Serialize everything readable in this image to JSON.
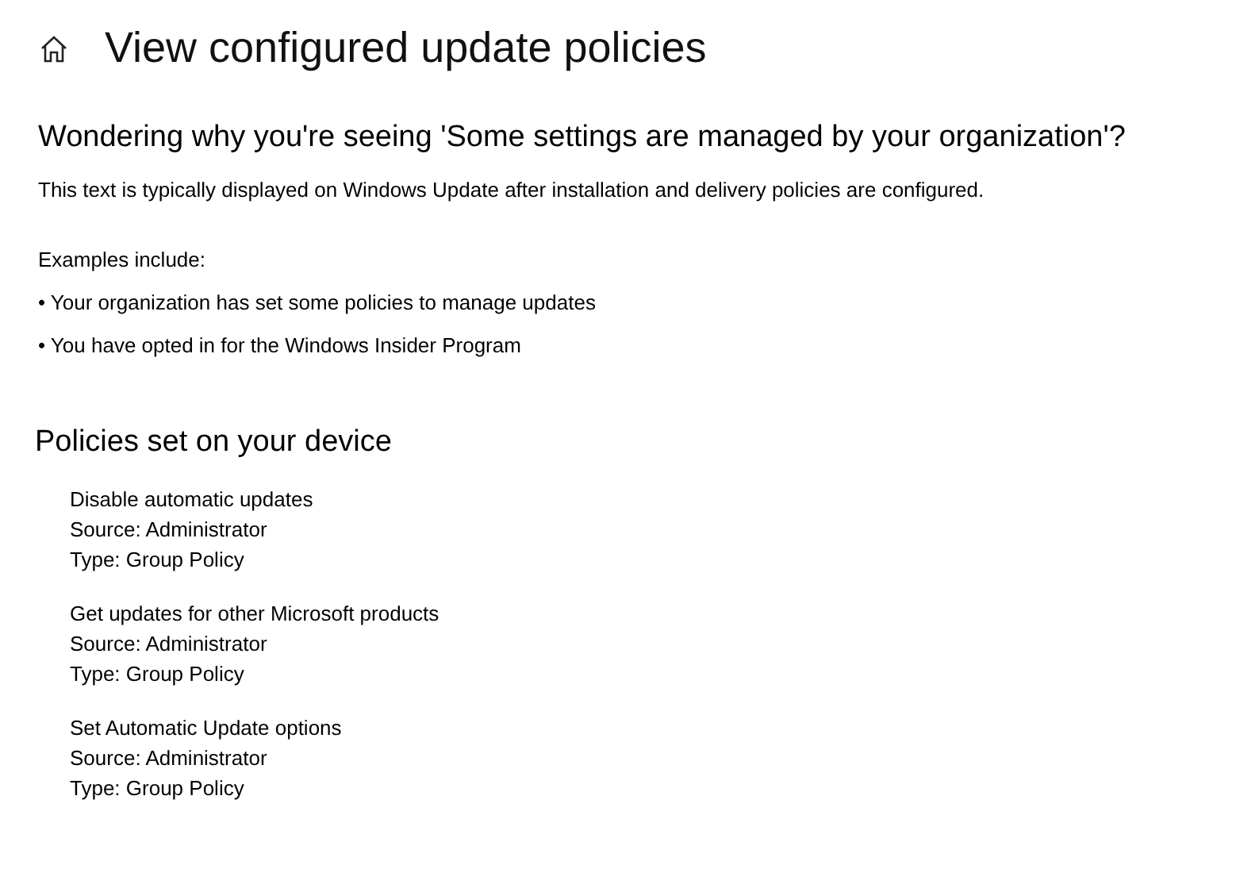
{
  "page": {
    "title": "View configured update policies"
  },
  "info": {
    "heading": "Wondering why you're seeing 'Some settings are managed by your organization'?",
    "description": "This text is typically displayed on Windows Update after installation and delivery policies are configured.",
    "examples_label": "Examples include:",
    "examples": [
      "• Your organization has set some policies to manage updates",
      "• You have opted in for the Windows Insider Program"
    ]
  },
  "policies": {
    "heading": "Policies set on your device",
    "items": [
      {
        "name": "Disable automatic updates",
        "source": "Source: Administrator",
        "type": "Type: Group Policy"
      },
      {
        "name": "Get updates for other Microsoft products",
        "source": "Source: Administrator",
        "type": "Type: Group Policy"
      },
      {
        "name": "Set Automatic Update options",
        "source": "Source: Administrator",
        "type": "Type: Group Policy"
      }
    ]
  }
}
